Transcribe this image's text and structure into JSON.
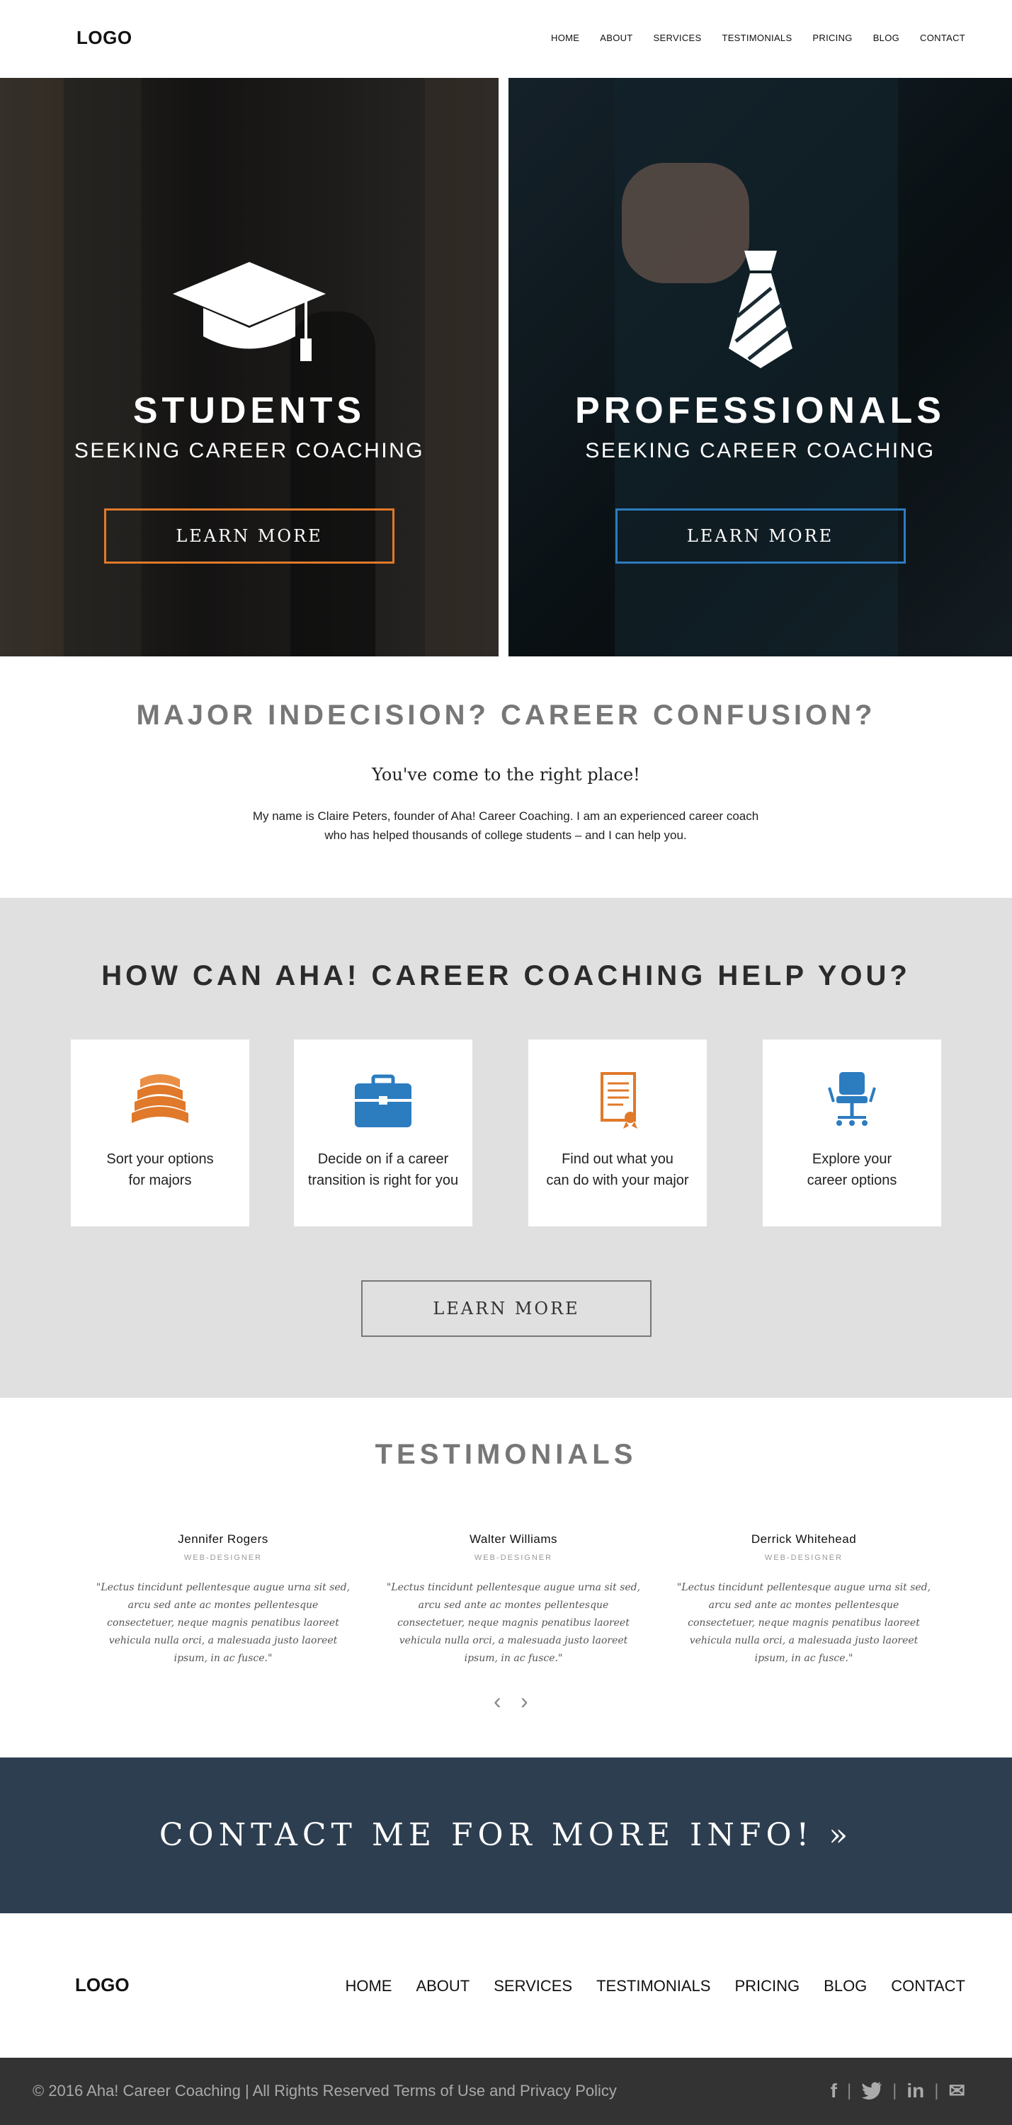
{
  "header": {
    "logo": "LOGO",
    "nav": [
      "HOME",
      "ABOUT",
      "SERVICES",
      "TESTIMONIALS",
      "PRICING",
      "BLOG",
      "CONTACT"
    ]
  },
  "hero": {
    "students": {
      "title": "STUDENTS",
      "subtitle": "SEEKING CAREER COACHING",
      "button": "LEARN MORE",
      "accent": "#e0792a"
    },
    "professionals": {
      "title": "PROFESSIONALS",
      "subtitle": "SEEKING CAREER COACHING",
      "button": "LEARN MORE",
      "accent": "#2c7cc0"
    }
  },
  "intro": {
    "title": "MAJOR INDECISION? CAREER CONFUSION?",
    "subtitle": "You've come to the right place!",
    "body_line1": "My name is Claire Peters, founder of Aha! Career Coaching. I am an experienced career coach",
    "body_line2": "who has helped thousands of college students – and I can help you."
  },
  "help": {
    "title": "HOW CAN AHA! CAREER COACHING HELP YOU?",
    "cards": [
      {
        "line1": "Sort your options",
        "line2": "for majors",
        "icon": "books-icon"
      },
      {
        "line1": "Decide on if a career",
        "line2": "transition is right for you",
        "icon": "briefcase-icon"
      },
      {
        "line1": "Find out what you",
        "line2": "can do with your major",
        "icon": "certificate-icon"
      },
      {
        "line1": "Explore your",
        "line2": "career options",
        "icon": "office-chair-icon"
      }
    ],
    "button": "LEARN MORE"
  },
  "testimonials": {
    "title": "TESTIMONIALS",
    "items": [
      {
        "name": "Jennifer Rogers",
        "role": "WEB-DESIGNER",
        "quote": "\"Lectus tincidunt pellentesque augue urna sit sed, arcu sed ante ac montes pellentesque consectetuer, neque magnis penatibus laoreet vehicula nulla orci, a malesuada justo laoreet ipsum, in ac fusce.\""
      },
      {
        "name": "Walter Williams",
        "role": "WEB-DESIGNER",
        "quote": "\"Lectus tincidunt pellentesque augue urna sit sed, arcu sed ante ac montes pellentesque consectetuer, neque magnis penatibus laoreet vehicula nulla orci, a malesuada justo laoreet ipsum, in ac fusce.\""
      },
      {
        "name": "Derrick Whitehead",
        "role": "WEB-DESIGNER",
        "quote": "\"Lectus tincidunt pellentesque augue urna sit sed, arcu sed ante ac montes pellentesque consectetuer, neque magnis penatibus laoreet vehicula nulla orci, a malesuada justo laoreet ipsum, in ac fusce.\""
      }
    ],
    "prev": "‹",
    "next": "›"
  },
  "contact": {
    "text": "CONTACT ME FOR MORE INFO!  »"
  },
  "footer": {
    "logo": "LOGO",
    "nav": [
      "HOME",
      "ABOUT",
      "SERVICES",
      "TESTIMONIALS",
      "PRICING",
      "BLOG",
      "CONTACT"
    ],
    "copyright": "© 2016 Aha! Career Coaching  |  All Rights Reserved Terms of Use and Privacy Policy",
    "social": {
      "facebook": "f",
      "twitter": "t",
      "linkedin": "in",
      "email": "✉",
      "separator": "|"
    }
  },
  "colors": {
    "accent_orange": "#e0792a",
    "accent_blue": "#2c7cc0",
    "banner": "#2d3e50",
    "footer_bar": "#333333"
  }
}
